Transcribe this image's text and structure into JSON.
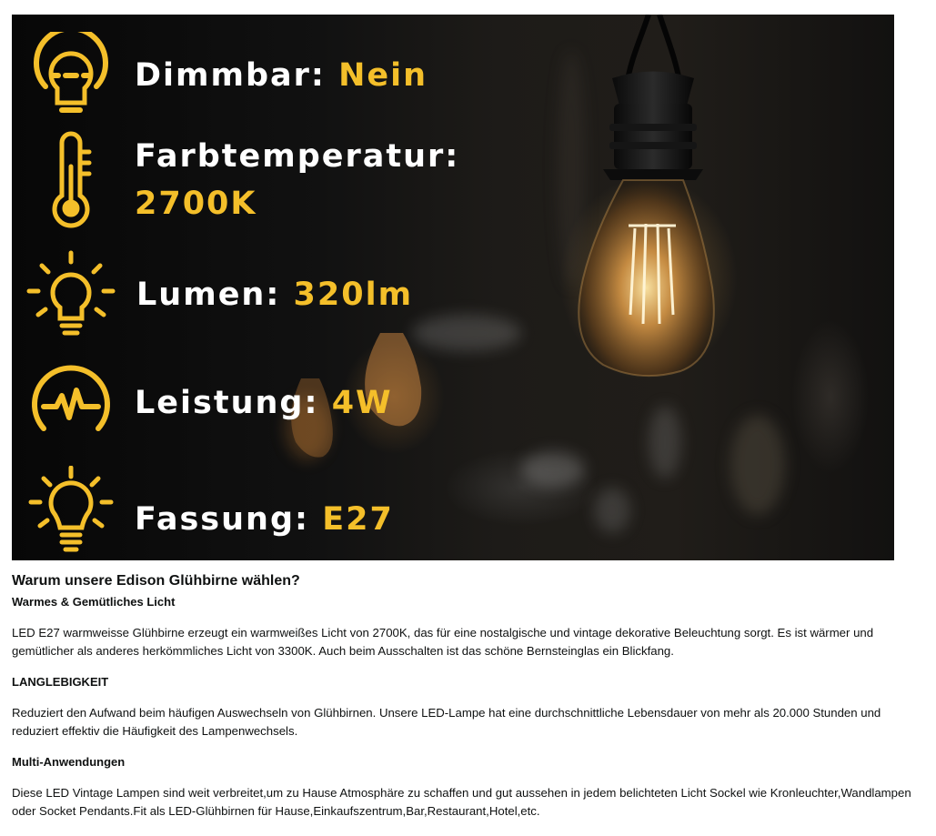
{
  "banner": {
    "features": [
      {
        "label": "Dimmbar:",
        "value": "Nein",
        "icon": "dimmable-bulb-icon"
      },
      {
        "label": "Farbtemperatur:",
        "value": "2700K",
        "icon": "thermometer-icon"
      },
      {
        "label": "Lumen:",
        "value": "320lm",
        "icon": "bright-bulb-icon"
      },
      {
        "label": "Leistung:",
        "value": "4W",
        "icon": "power-pulse-icon"
      },
      {
        "label": "Fassung:",
        "value": "E27",
        "icon": "socket-bulb-icon"
      }
    ],
    "accent_color": "#f4bf2a"
  },
  "description": {
    "heading": "Warum unsere Edison Glühbirne wählen?",
    "sections": [
      {
        "title": "Warmes & Gemütliches Licht",
        "text": "LED E27 warmweisse Glühbirne erzeugt ein warmweißes Licht von 2700K, das für eine nostalgische und vintage dekorative Beleuchtung sorgt. Es ist wärmer und gemütlicher als anderes herkömmliches Licht von 3300K. Auch beim Ausschalten ist das schöne Bernsteinglas ein Blickfang."
      },
      {
        "title": "LANGLEBIGKEIT",
        "text": "Reduziert den Aufwand beim häufigen Auswechseln von Glühbirnen. Unsere LED-Lampe hat eine durchschnittliche Lebensdauer von mehr als 20.000 Stunden und reduziert effektiv die Häufigkeit des Lampenwechsels."
      },
      {
        "title": "Multi-Anwendungen",
        "text": "Diese LED Vintage Lampen sind weit verbreitet,um zu Hause Atmosphäre zu schaffen und gut aussehen in jedem belichteten Licht Sockel wie Kronleuchter,Wandlampen oder Socket Pendants.Fit als LED-Glühbirnen für Hause,Einkaufszentrum,Bar,Restaurant,Hotel,etc."
      }
    ]
  }
}
